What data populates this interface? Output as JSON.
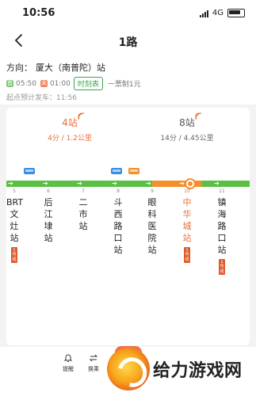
{
  "status": {
    "time": "10:56",
    "network": "4G"
  },
  "nav": {
    "title": "1路"
  },
  "info": {
    "direction_label": "方向：",
    "direction_value": "厦大（南普陀）站",
    "first_badge": "首",
    "first_time": "05:50",
    "last_badge": "末",
    "last_time": "01:00",
    "timetable_button": "时刻表",
    "fare": "一票制1元",
    "eta_label": "起点预计发车：",
    "eta_time": "11:56"
  },
  "buses": [
    {
      "stops": "4站",
      "detail": "4分 / 1.2公里"
    },
    {
      "stops": "8站",
      "detail": "14分 / 4.45公里"
    }
  ],
  "stations": [
    {
      "index": "5",
      "name": "BRT文灶站",
      "metro": "1号线"
    },
    {
      "index": "6",
      "name": "后江埭站",
      "metro": ""
    },
    {
      "index": "7",
      "name": "二市站",
      "metro": ""
    },
    {
      "index": "8",
      "name": "斗西路口站",
      "metro": ""
    },
    {
      "index": "9",
      "name": "眼科医院站",
      "metro": ""
    },
    {
      "index": "10",
      "name": "中华城站",
      "metro": "1号线"
    },
    {
      "index": "11",
      "name": "镇海路口站",
      "metro": "1号线"
    }
  ],
  "tabs": [
    {
      "label": "提醒"
    },
    {
      "label": "换乘"
    }
  ],
  "watermark": {
    "text": "给力游戏网"
  },
  "colors": {
    "green": "#5bbf46",
    "orange": "#f3902e",
    "accent": "#e8703a",
    "metro": "#e05b2a"
  }
}
